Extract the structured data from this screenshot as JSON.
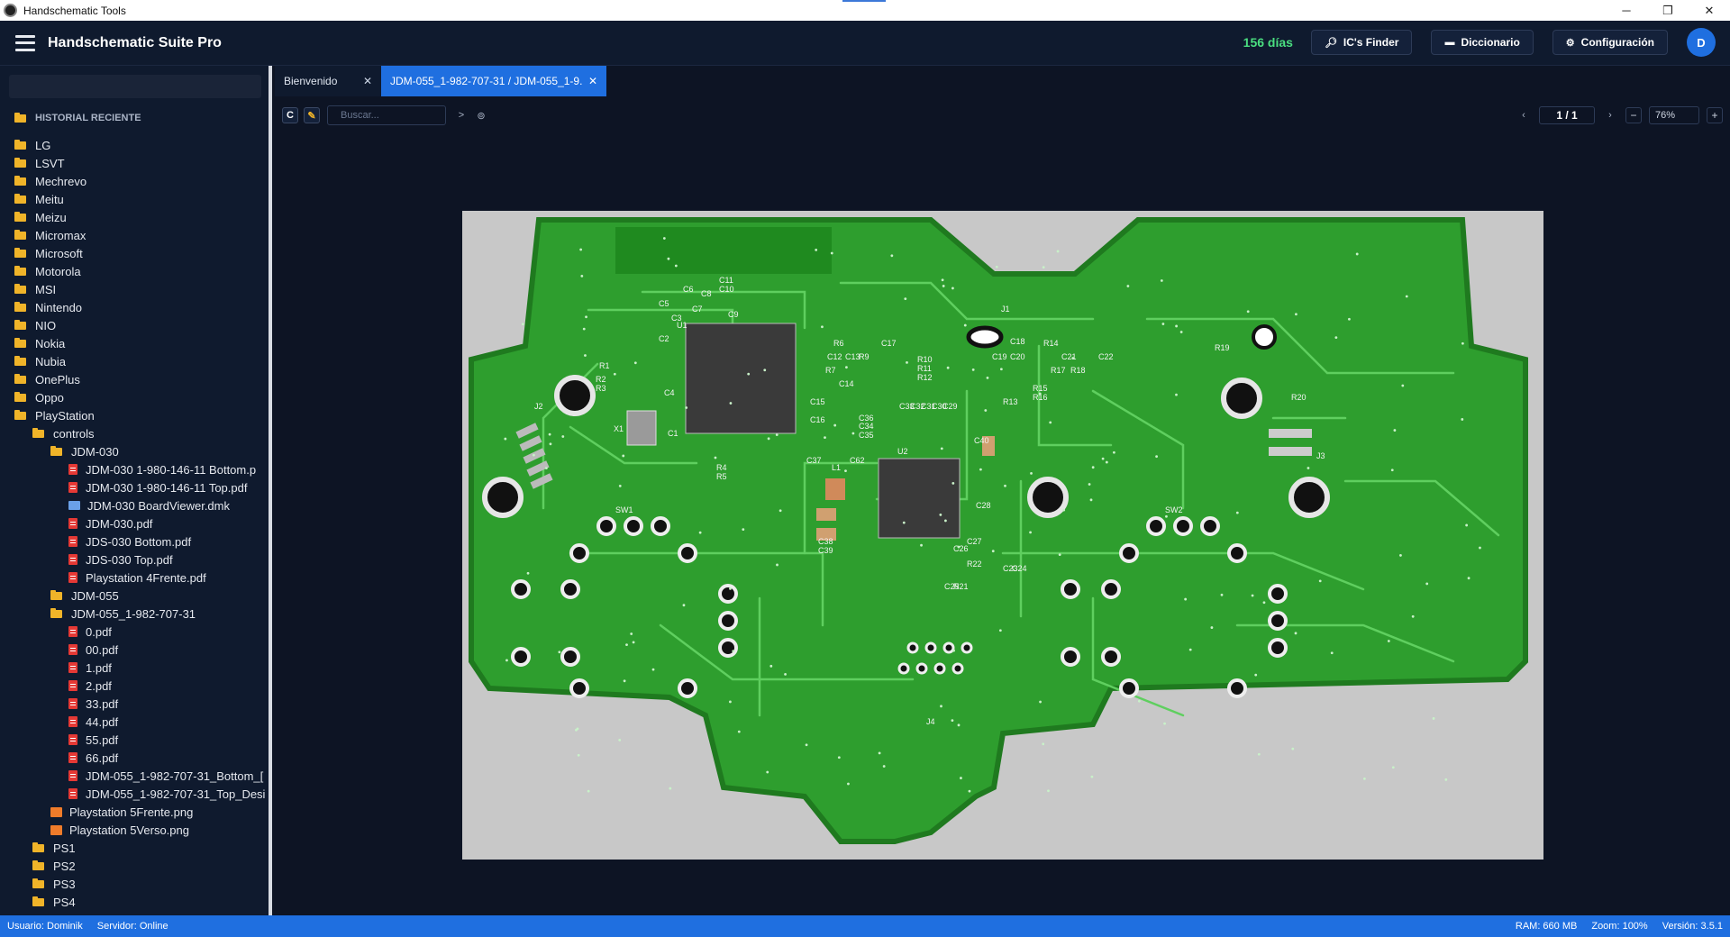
{
  "window": {
    "title": "Handschematic Tools"
  },
  "header": {
    "app_name": "Handschematic Suite Pro",
    "days_remaining": "156 días",
    "buttons": {
      "ic_finder": "IC's Finder",
      "dictionary": "Diccionario",
      "settings": "Configuración"
    },
    "avatar_initial": "D",
    "days_color": "#4ade80"
  },
  "sidebar": {
    "search_placeholder": "",
    "section_title": "HISTORIAL RECIENTE",
    "items": [
      {
        "label": "LG",
        "type": "folder",
        "level": 0
      },
      {
        "label": "LSVT",
        "type": "folder",
        "level": 0
      },
      {
        "label": "Mechrevo",
        "type": "folder",
        "level": 0
      },
      {
        "label": "Meitu",
        "type": "folder",
        "level": 0
      },
      {
        "label": "Meizu",
        "type": "folder",
        "level": 0
      },
      {
        "label": "Micromax",
        "type": "folder",
        "level": 0
      },
      {
        "label": "Microsoft",
        "type": "folder",
        "level": 0
      },
      {
        "label": "Motorola",
        "type": "folder",
        "level": 0
      },
      {
        "label": "MSI",
        "type": "folder",
        "level": 0
      },
      {
        "label": "Nintendo",
        "type": "folder",
        "level": 0
      },
      {
        "label": "NIO",
        "type": "folder",
        "level": 0
      },
      {
        "label": "Nokia",
        "type": "folder",
        "level": 0
      },
      {
        "label": "Nubia",
        "type": "folder",
        "level": 0
      },
      {
        "label": "OnePlus",
        "type": "folder",
        "level": 0
      },
      {
        "label": "Oppo",
        "type": "folder",
        "level": 0
      },
      {
        "label": "PlayStation",
        "type": "folder",
        "level": 0
      },
      {
        "label": "controls",
        "type": "folder",
        "level": 1
      },
      {
        "label": "JDM-030",
        "type": "folder",
        "level": 2
      },
      {
        "label": "JDM-030 1-980-146-11 Bottom.p",
        "type": "pdf",
        "level": 3
      },
      {
        "label": "JDM-030 1-980-146-11 Top.pdf",
        "type": "pdf",
        "level": 3
      },
      {
        "label": "JDM-030 BoardViewer.dmk",
        "type": "dmk",
        "level": 3
      },
      {
        "label": "JDM-030.pdf",
        "type": "pdf",
        "level": 3
      },
      {
        "label": "JDS-030 Bottom.pdf",
        "type": "pdf",
        "level": 3
      },
      {
        "label": "JDS-030 Top.pdf",
        "type": "pdf",
        "level": 3
      },
      {
        "label": "Playstation 4Frente.pdf",
        "type": "pdf",
        "level": 3
      },
      {
        "label": "JDM-055",
        "type": "folder",
        "level": 2
      },
      {
        "label": "JDM-055_1-982-707-31",
        "type": "folder",
        "level": 2
      },
      {
        "label": "0.pdf",
        "type": "pdf",
        "level": 3
      },
      {
        "label": "00.pdf",
        "type": "pdf",
        "level": 3
      },
      {
        "label": "1.pdf",
        "type": "pdf",
        "level": 3
      },
      {
        "label": "2.pdf",
        "type": "pdf",
        "level": 3
      },
      {
        "label": "33.pdf",
        "type": "pdf",
        "level": 3
      },
      {
        "label": "44.pdf",
        "type": "pdf",
        "level": 3
      },
      {
        "label": "55.pdf",
        "type": "pdf",
        "level": 3
      },
      {
        "label": "66.pdf",
        "type": "pdf",
        "level": 3
      },
      {
        "label": "JDM-055_1-982-707-31_Bottom_[",
        "type": "pdf",
        "level": 3
      },
      {
        "label": "JDM-055_1-982-707-31_Top_Desi",
        "type": "pdf",
        "level": 3
      },
      {
        "label": "Playstation 5Frente.png",
        "type": "png",
        "level": 2
      },
      {
        "label": "Playstation 5Verso.png",
        "type": "png",
        "level": 2
      },
      {
        "label": "PS1",
        "type": "folder",
        "level": 1
      },
      {
        "label": "PS2",
        "type": "folder",
        "level": 1
      },
      {
        "label": "PS3",
        "type": "folder",
        "level": 1
      },
      {
        "label": "PS4",
        "type": "folder",
        "level": 1
      }
    ]
  },
  "tabs": [
    {
      "label": "Bienvenido",
      "active": false
    },
    {
      "label": "JDM-055_1-982-707-31 / JDM-055_1-9...",
      "active": true
    }
  ],
  "toolbar": {
    "c_button": "C",
    "edit_icon": "pencil-icon",
    "search_placeholder": "Buscar...",
    "go_label": ">",
    "page_prev": "‹",
    "page_indicator": "1 / 1",
    "page_next": "›",
    "zoom_out": "−",
    "zoom_value": "76%",
    "zoom_in": "+"
  },
  "pcb": {
    "board_color": "#2e9e2e",
    "labels": [
      "C11",
      "C10",
      "C6",
      "C8",
      "C5",
      "C7",
      "C9",
      "C3",
      "U1",
      "C2",
      "R6",
      "C12",
      "C13",
      "R9",
      "C17",
      "R10",
      "R11",
      "R12",
      "J1",
      "C18",
      "R14",
      "C19",
      "C20",
      "C21",
      "C22",
      "R19",
      "R17",
      "R18",
      "R15",
      "R16",
      "R13",
      "R1",
      "R2",
      "R3",
      "C4",
      "C14",
      "C15",
      "C16",
      "R7",
      "C33",
      "C32",
      "C31",
      "C30",
      "C29",
      "R20",
      "J2",
      "X1",
      "C1",
      "C36",
      "C34",
      "C35",
      "C40",
      "U2",
      "C37",
      "L1",
      "C62",
      "R4",
      "R5",
      "J3",
      "SW1",
      "SW2",
      "C28",
      "C27",
      "C26",
      "C38",
      "C39",
      "R22",
      "R21",
      "C25",
      "C23",
      "C24",
      "J4"
    ]
  },
  "statusbar": {
    "user": "Usuario: Dominik",
    "server": "Servidor: Online",
    "ram": "RAM: 660 MB",
    "zoom": "Zoom: 100%",
    "version": "Versión: 3.5.1"
  }
}
